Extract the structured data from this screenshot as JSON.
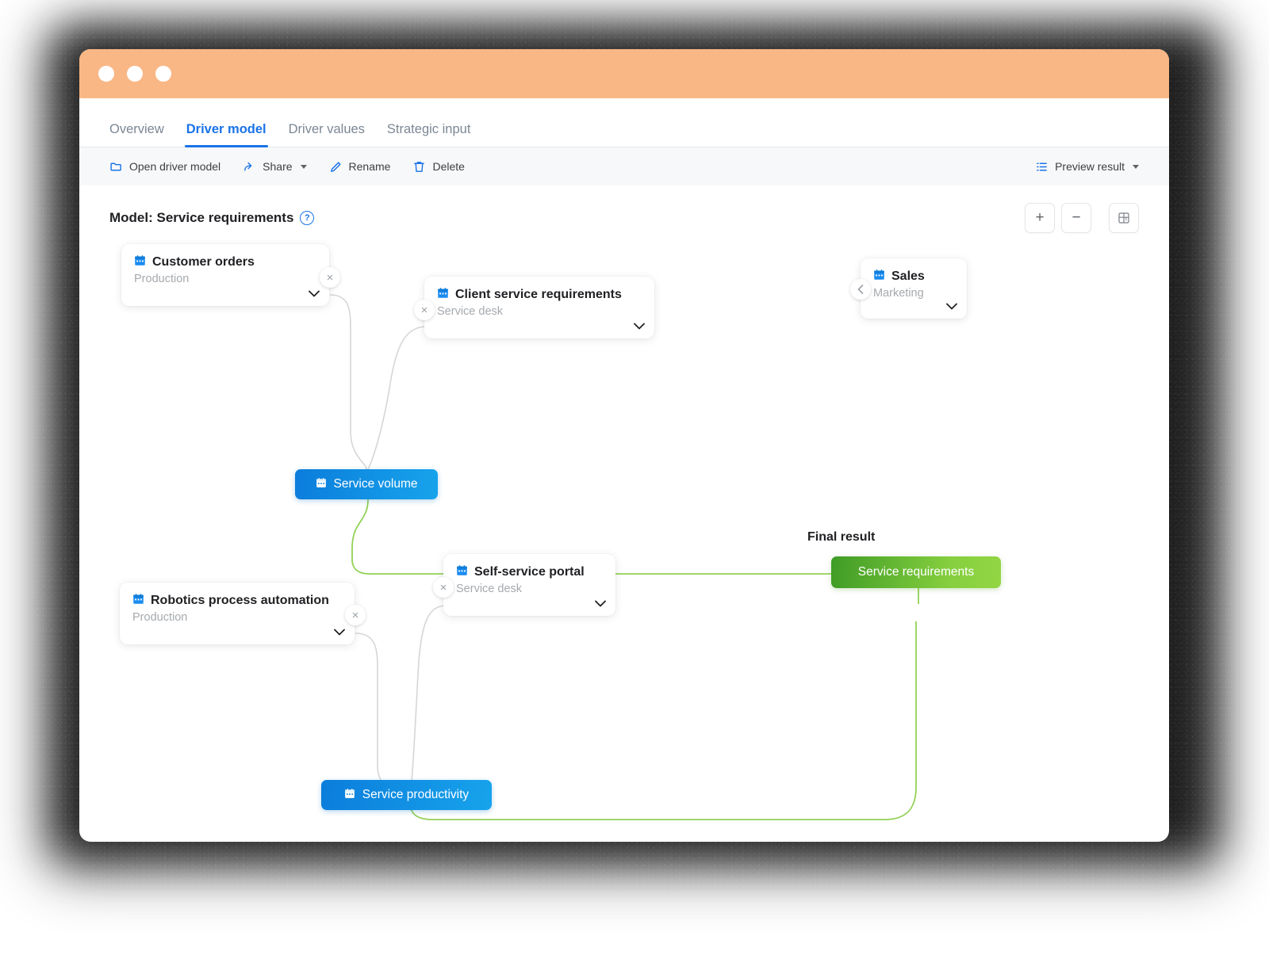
{
  "window": {
    "titlebar_dots": [
      "close-dot",
      "minimize-dot",
      "maximize-dot"
    ]
  },
  "tabs": [
    {
      "label": "Overview",
      "active": false
    },
    {
      "label": "Driver model",
      "active": true
    },
    {
      "label": "Driver values",
      "active": false
    },
    {
      "label": "Strategic input",
      "active": false
    }
  ],
  "toolbar": {
    "items": [
      {
        "label": "Open driver model",
        "icon": "folder-icon",
        "has_caret": false
      },
      {
        "label": "Share",
        "icon": "share-icon",
        "has_caret": true
      },
      {
        "label": "Rename",
        "icon": "pencil-icon",
        "has_caret": false
      },
      {
        "label": "Delete",
        "icon": "trash-icon",
        "has_caret": false
      }
    ],
    "preview": {
      "label": "Preview result",
      "icon": "list-icon",
      "has_caret": true
    }
  },
  "model": {
    "title": "Model: Service requirements",
    "help_icon": "?"
  },
  "zoom_controls": [
    {
      "name": "zoom-in-button",
      "glyph": "+"
    },
    {
      "name": "zoom-out-button",
      "glyph": "−"
    },
    {
      "name": "fit-to-screen-button",
      "glyph": "⊞"
    }
  ],
  "canvas": {
    "nodes": [
      {
        "id": "customer-orders",
        "title": "Customer orders",
        "subtitle": "Production",
        "icon": "calendar-icon",
        "chevron": "chevron-down-icon",
        "badge": "remove-icon"
      },
      {
        "id": "client-service-requirements",
        "title": "Client service requirements",
        "subtitle": "Service desk",
        "icon": "calendar-icon",
        "chevron": "chevron-down-icon",
        "badge": "remove-icon"
      },
      {
        "id": "sales",
        "title": "Sales",
        "subtitle": "Marketing",
        "icon": "calendar-icon",
        "chevron": "chevron-down-icon",
        "badge": "collapse-icon"
      },
      {
        "id": "robotics-process-automation",
        "title": "Robotics process automation",
        "subtitle": "Production",
        "icon": "calendar-icon",
        "chevron": "chevron-down-icon",
        "badge": "remove-icon"
      },
      {
        "id": "self-service-portal",
        "title": "Self-service portal",
        "subtitle": "Service desk",
        "icon": "calendar-icon",
        "chevron": "chevron-down-icon",
        "badge": "remove-icon"
      }
    ],
    "pills": [
      {
        "id": "service-volume",
        "label": "Service volume",
        "color": "#1190e3",
        "icon": "calendar-icon"
      },
      {
        "id": "service-productivity",
        "label": "Service productivity",
        "color": "#1190e3",
        "icon": "calendar-icon"
      }
    ],
    "final": {
      "label": "Final result",
      "pill_label": "Service requirements",
      "color": "#61bd34"
    }
  },
  "colors": {
    "titlebar": "#f9b785",
    "accent_blue": "#1a73e8",
    "pill_blue": "#1190e3",
    "pill_green": "#61bd34",
    "edge_gray": "#d2d4d7",
    "edge_green": "#93d157"
  }
}
